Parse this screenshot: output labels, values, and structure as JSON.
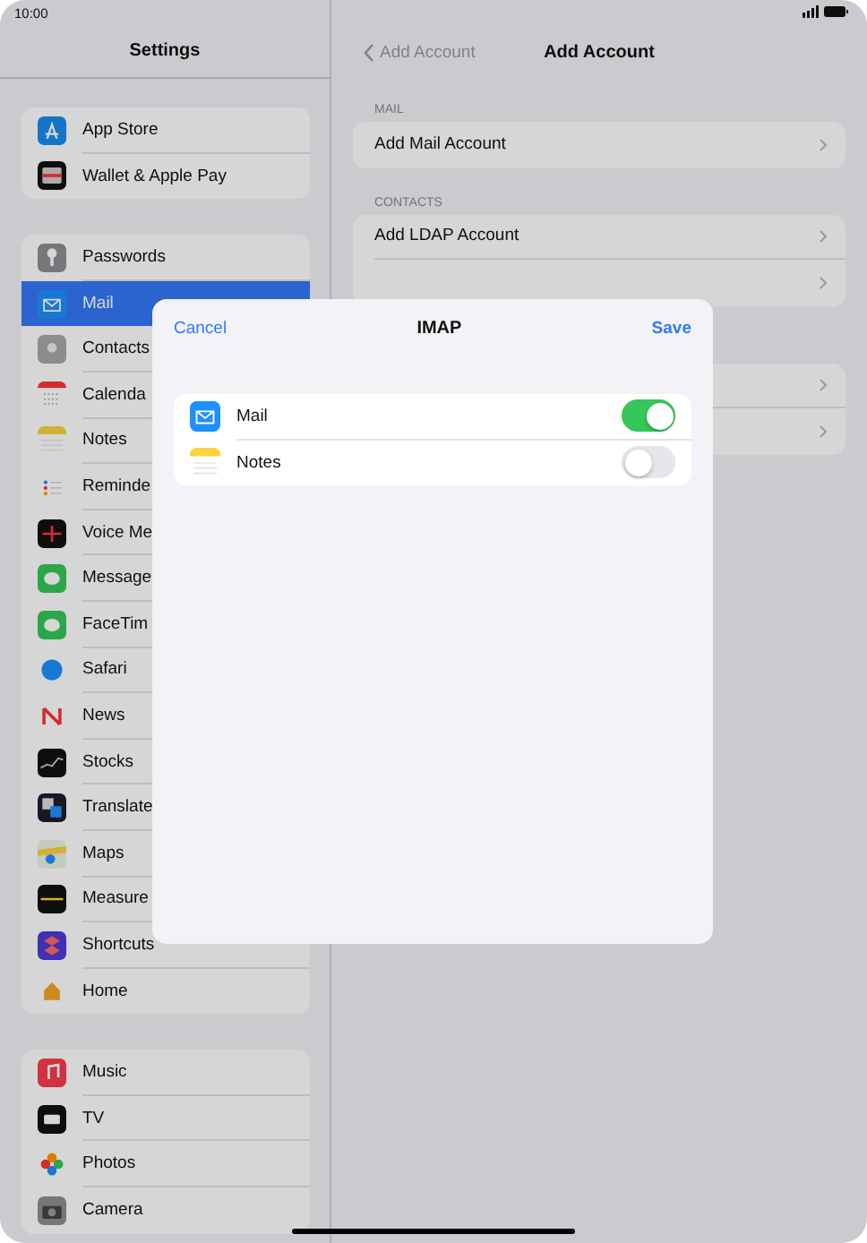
{
  "status_bar": {
    "time": "10:00"
  },
  "sidebar": {
    "title": "Settings",
    "groups": [
      [
        {
          "label": "App Store",
          "kind": "appstore",
          "selected": false
        },
        {
          "label": "Wallet & Apple Pay",
          "kind": "wallet",
          "selected": false
        }
      ],
      [
        {
          "label": "Passwords",
          "kind": "passwords",
          "selected": false
        },
        {
          "label": "Mail",
          "kind": "mail",
          "selected": true
        },
        {
          "label": "Contacts",
          "kind": "contacts",
          "selected": false
        },
        {
          "label": "Calenda",
          "kind": "calendar",
          "selected": false
        },
        {
          "label": "Notes",
          "kind": "notes",
          "selected": false
        },
        {
          "label": "Reminde",
          "kind": "reminders",
          "selected": false
        },
        {
          "label": "Voice Me",
          "kind": "voice",
          "selected": false
        },
        {
          "label": "Message",
          "kind": "messages",
          "selected": false
        },
        {
          "label": "FaceTim",
          "kind": "facetime",
          "selected": false
        },
        {
          "label": "Safari",
          "kind": "safari",
          "selected": false
        },
        {
          "label": "News",
          "kind": "news",
          "selected": false
        },
        {
          "label": "Stocks",
          "kind": "stocks",
          "selected": false
        },
        {
          "label": "Translate",
          "kind": "translate",
          "selected": false
        },
        {
          "label": "Maps",
          "kind": "maps",
          "selected": false
        },
        {
          "label": "Measure",
          "kind": "measure",
          "selected": false
        },
        {
          "label": "Shortcuts",
          "kind": "shortcuts",
          "selected": false
        },
        {
          "label": "Home",
          "kind": "home",
          "selected": false
        }
      ],
      [
        {
          "label": "Music",
          "kind": "music",
          "selected": false
        },
        {
          "label": "TV",
          "kind": "tv",
          "selected": false
        },
        {
          "label": "Photos",
          "kind": "photos",
          "selected": false
        },
        {
          "label": "Camera",
          "kind": "camera",
          "selected": false
        }
      ]
    ]
  },
  "detail": {
    "back": "Add Account",
    "title": "Add Account",
    "sections": [
      {
        "header": "MAIL",
        "rows": [
          {
            "kind": "link",
            "label": "Add Mail Account"
          }
        ]
      },
      {
        "header": "CONTACTS",
        "rows": [
          {
            "kind": "link",
            "label": "Add LDAP Account"
          },
          {
            "kind": "covered"
          }
        ]
      },
      {
        "rows": [
          {
            "kind": "covered"
          },
          {
            "kind": "covered"
          }
        ]
      }
    ]
  },
  "sheet": {
    "cancel": "Cancel",
    "title": "IMAP",
    "save": "Save",
    "items": [
      {
        "label": "Mail",
        "kind": "mail",
        "on": true
      },
      {
        "label": "Notes",
        "kind": "notes",
        "on": false
      }
    ]
  }
}
